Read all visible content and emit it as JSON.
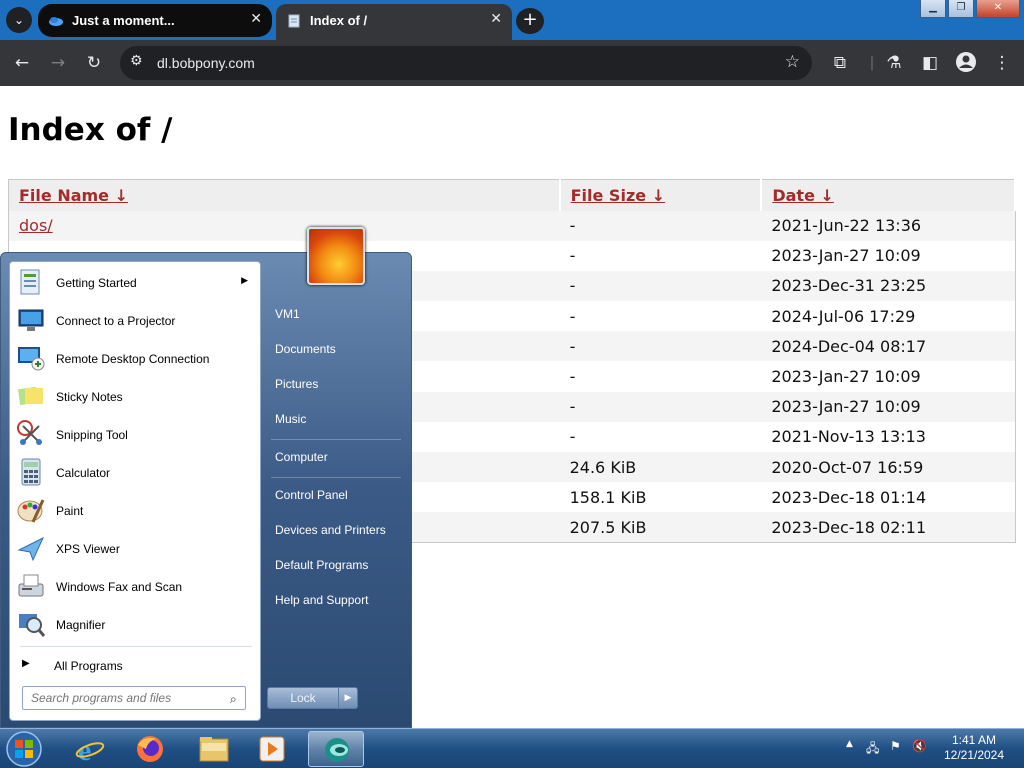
{
  "browser": {
    "tabs": [
      {
        "title": "Just a moment...",
        "active": false
      },
      {
        "title": "Index of /",
        "active": true
      }
    ],
    "close_glyph": "✕",
    "new_tab_glyph": "+",
    "url": "dl.bobpony.com"
  },
  "page": {
    "title": "Index of /",
    "columns": [
      {
        "label": "File Name",
        "sort": "↓"
      },
      {
        "label": "File Size",
        "sort": "↓"
      },
      {
        "label": "Date",
        "sort": "↓"
      }
    ],
    "rows": [
      {
        "name": "dos/",
        "size": "-",
        "date": "2021-Jun-22 13:36"
      },
      {
        "name": "",
        "size": "-",
        "date": "2023-Jan-27 10:09"
      },
      {
        "name": "",
        "size": "-",
        "date": "2023-Dec-31 23:25"
      },
      {
        "name": "",
        "size": "-",
        "date": "2024-Jul-06 17:29"
      },
      {
        "name": "",
        "size": "-",
        "date": "2024-Dec-04 08:17"
      },
      {
        "name": "",
        "size": "-",
        "date": "2023-Jan-27 10:09"
      },
      {
        "name": "",
        "size": "-",
        "date": "2023-Jan-27 10:09"
      },
      {
        "name": "",
        "size": "-",
        "date": "2021-Nov-13 13:13"
      },
      {
        "name": "",
        "size": "24.6 KiB",
        "date": "2020-Oct-07 16:59"
      },
      {
        "name": "",
        "size": "158.1 KiB",
        "date": "2023-Dec-18 01:14"
      },
      {
        "name": "",
        "size": "207.5 KiB",
        "date": "2023-Dec-18 02:11"
      }
    ]
  },
  "start_menu": {
    "programs": [
      {
        "label": "Getting Started",
        "icon": "getting-started-icon",
        "has_submenu": true
      },
      {
        "label": "Connect to a Projector",
        "icon": "projector-icon",
        "has_submenu": false
      },
      {
        "label": "Remote Desktop Connection",
        "icon": "remote-desktop-icon",
        "has_submenu": false
      },
      {
        "label": "Sticky Notes",
        "icon": "sticky-notes-icon",
        "has_submenu": false
      },
      {
        "label": "Snipping Tool",
        "icon": "snipping-tool-icon",
        "has_submenu": false
      },
      {
        "label": "Calculator",
        "icon": "calculator-icon",
        "has_submenu": false
      },
      {
        "label": "Paint",
        "icon": "paint-icon",
        "has_submenu": false
      },
      {
        "label": "XPS Viewer",
        "icon": "xps-viewer-icon",
        "has_submenu": false
      },
      {
        "label": "Windows Fax and Scan",
        "icon": "fax-scan-icon",
        "has_submenu": false
      },
      {
        "label": "Magnifier",
        "icon": "magnifier-icon",
        "has_submenu": false
      }
    ],
    "all_programs": "All Programs",
    "search_placeholder": "Search programs and files",
    "right_items": [
      "VM1",
      "Documents",
      "Pictures",
      "Music",
      "Computer",
      "Control Panel",
      "Devices and Printers",
      "Default Programs",
      "Help and Support"
    ],
    "lock_label": "Lock"
  },
  "taskbar": {
    "clock_time": "1:41 AM",
    "clock_date": "12/21/2024"
  },
  "colors": {
    "link": "#a52a2a",
    "chrome_dark": "#35363a",
    "taskbar_blue": "#1f4f84"
  }
}
